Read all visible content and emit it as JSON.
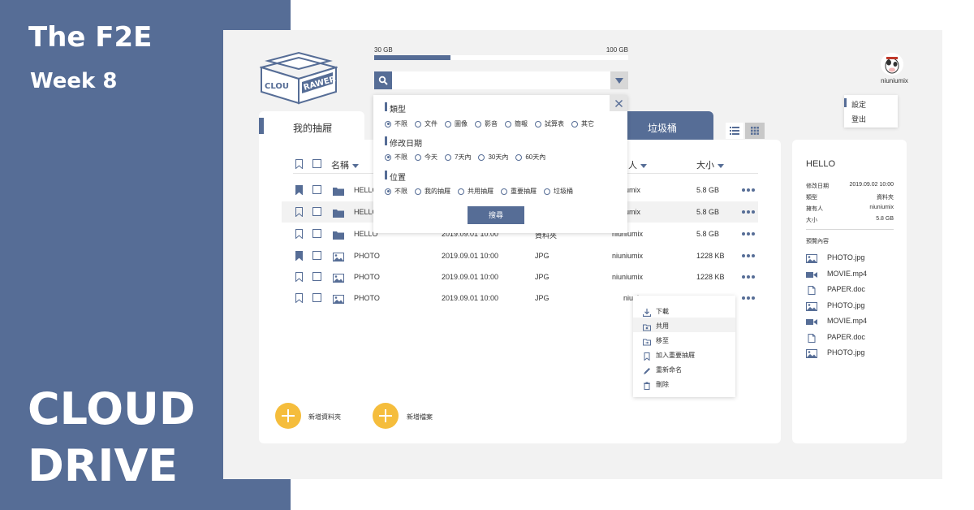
{
  "banner": {
    "title_line1": "The F2E",
    "title_line2": "Week 8",
    "big_line1": "CLOUD",
    "big_line2": "DRIVE"
  },
  "logo": {
    "text_left": "CLOU",
    "text_right": "RAWER"
  },
  "storage": {
    "used_label": "30 GB",
    "total_label": "100 GB",
    "used_fraction": 0.3
  },
  "search": {
    "value": "",
    "placeholder": ""
  },
  "user": {
    "name": "niuniumix"
  },
  "user_menu": {
    "settings": "設定",
    "logout": "登出"
  },
  "tabs": {
    "active": "我的抽屜",
    "trash": "垃圾桶"
  },
  "filter": {
    "type_title": "類型",
    "type_options": [
      "不限",
      "文件",
      "圖像",
      "影音",
      "簡報",
      "試算表",
      "其它"
    ],
    "date_title": "修改日期",
    "date_options": [
      "不限",
      "今天",
      "7天內",
      "30天內",
      "60天內"
    ],
    "location_title": "位置",
    "location_options": [
      "不限",
      "我的抽屜",
      "共用抽屜",
      "重要抽屜",
      "垃圾桶"
    ],
    "search_button": "搜尋"
  },
  "table": {
    "headers": {
      "name": "名稱",
      "owner": "人",
      "size": "大小"
    },
    "rows": [
      {
        "name": "HELLO",
        "date": "",
        "type": "",
        "owner": "iumix",
        "size": "5.8 GB",
        "icon": "folder-icon",
        "bookmarked": true
      },
      {
        "name": "HELLO",
        "date": "",
        "type": "",
        "owner": "iumix",
        "size": "5.8 GB",
        "icon": "folder-icon",
        "bookmarked": false
      },
      {
        "name": "HELLO",
        "date": "2019.09.01 10:00",
        "type": "資料夾",
        "owner": "niuniumix",
        "size": "5.8 GB",
        "icon": "folder-icon",
        "bookmarked": false
      },
      {
        "name": "PHOTO",
        "date": "2019.09.01 10:00",
        "type": "JPG",
        "owner": "niuniumix",
        "size": "1228 KB",
        "icon": "image-icon",
        "bookmarked": true
      },
      {
        "name": "PHOTO",
        "date": "2019.09.01 10:00",
        "type": "JPG",
        "owner": "niuniumix",
        "size": "1228 KB",
        "icon": "image-icon",
        "bookmarked": false
      },
      {
        "name": "PHOTO",
        "date": "2019.09.01 10:00",
        "type": "JPG",
        "owner": "niuni",
        "size": "",
        "icon": "image-icon",
        "bookmarked": false
      }
    ]
  },
  "context_menu": [
    "下載",
    "共用",
    "移至",
    "加入重要抽屜",
    "重新命名",
    "刪除"
  ],
  "actions": {
    "new_folder": "新增資料夾",
    "new_file": "新增檔案"
  },
  "details": {
    "title": "HELLO",
    "fields": [
      {
        "label": "修改日期",
        "value": "2019.09.02 10:00"
      },
      {
        "label": "類型",
        "value": "資料夾"
      },
      {
        "label": "擁有人",
        "value": "niuniumix"
      },
      {
        "label": "大小",
        "value": "5.8 GB"
      }
    ],
    "preview_label": "預覽內容",
    "preview_items": [
      {
        "name": "PHOTO.jpg",
        "icon": "image-icon"
      },
      {
        "name": "MOVIE.mp4",
        "icon": "video-icon"
      },
      {
        "name": "PAPER.doc",
        "icon": "document-icon"
      },
      {
        "name": "PHOTO.jpg",
        "icon": "image-icon"
      },
      {
        "name": "MOVIE.mp4",
        "icon": "video-icon"
      },
      {
        "name": "PAPER.doc",
        "icon": "document-icon"
      },
      {
        "name": "PHOTO.jpg",
        "icon": "image-icon"
      }
    ]
  },
  "colors": {
    "primary": "#566d96",
    "accent": "#f5bd3c",
    "background": "#f2f2f2"
  }
}
